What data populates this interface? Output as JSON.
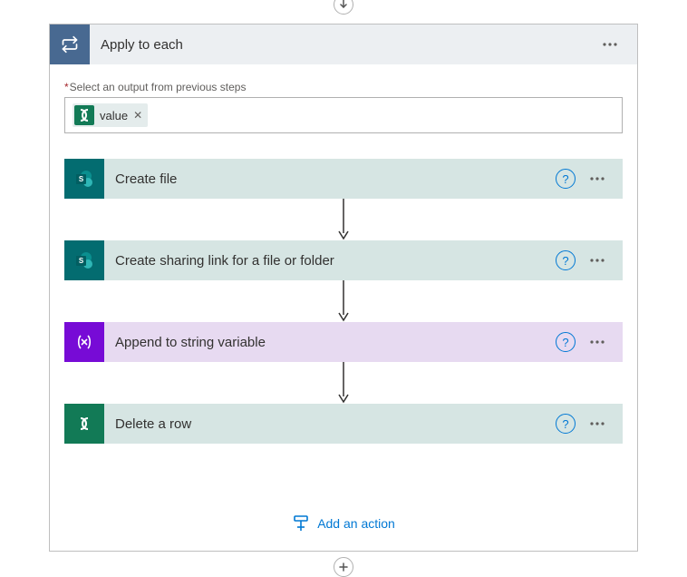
{
  "header": {
    "title": "Apply to each"
  },
  "output_selector": {
    "label": "Select an output from previous steps",
    "token_label": "value"
  },
  "steps": [
    {
      "type": "sharepoint",
      "title": "Create file"
    },
    {
      "type": "sharepoint",
      "title": "Create sharing link for a file or folder"
    },
    {
      "type": "variable",
      "title": "Append to string variable"
    },
    {
      "type": "dataverse",
      "title": "Delete a row"
    }
  ],
  "add_action_label": "Add an action"
}
